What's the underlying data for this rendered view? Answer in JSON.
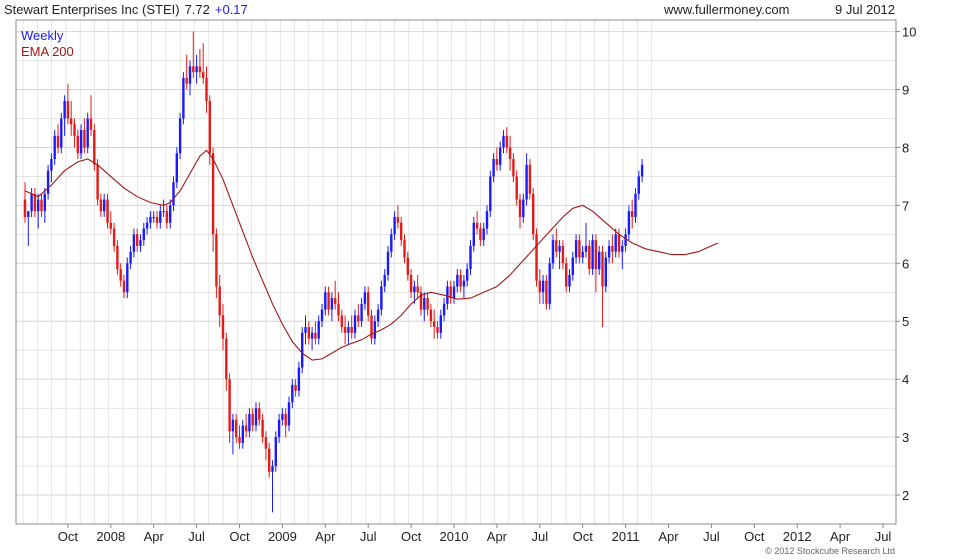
{
  "header": {
    "title": "Stewart Enterprises Inc (STEI)",
    "price": "7.72",
    "change": "+0.17",
    "site": "www.fullermoney.com",
    "date": "9 Jul 2012"
  },
  "legend": {
    "period": "Weekly",
    "ema": "EMA 200"
  },
  "footer": {
    "copyright": "© 2012 Stockcube Research Ltd"
  },
  "colors": {
    "up": "#1a1aff",
    "down": "#e41b17",
    "ema": "#a01818",
    "grid": "#d6d6d6",
    "axis": "#888888",
    "change_text": "#1a1aff",
    "period_text": "#1a1aff",
    "ema_text": "#a01818"
  },
  "chart_data": {
    "type": "candlestick",
    "ylim": [
      1.5,
      10.2
    ],
    "yticks": [
      "2",
      "3",
      "4",
      "5",
      "6",
      "7",
      "8",
      "9",
      "10"
    ],
    "xticks": [
      "Oct",
      "2008",
      "Apr",
      "Jul",
      "Oct",
      "2009",
      "Apr",
      "Jul",
      "Oct",
      "2010",
      "Apr",
      "Jul",
      "Oct",
      "2011",
      "Apr",
      "Jul",
      "Oct",
      "2012",
      "Apr",
      "Jul"
    ],
    "xtick_weeks": [
      13,
      26,
      39,
      52,
      65,
      78,
      91,
      104,
      117,
      130,
      143,
      156,
      169,
      182,
      195,
      208,
      221,
      234,
      247,
      260
    ],
    "candles": [
      [
        7.1,
        7.4,
        6.7,
        6.8
      ],
      [
        6.8,
        6.9,
        6.3,
        6.9
      ],
      [
        6.9,
        7.3,
        6.8,
        7.2
      ],
      [
        7.2,
        7.3,
        6.8,
        6.9
      ],
      [
        6.9,
        7.2,
        6.6,
        7.1
      ],
      [
        7.1,
        7.2,
        6.8,
        6.9
      ],
      [
        6.9,
        7.3,
        6.7,
        7.2
      ],
      [
        7.2,
        7.7,
        7.1,
        7.6
      ],
      [
        7.6,
        7.9,
        7.4,
        7.8
      ],
      [
        7.8,
        8.3,
        7.7,
        8.2
      ],
      [
        8.2,
        8.4,
        7.9,
        8.0
      ],
      [
        8.0,
        8.6,
        7.9,
        8.5
      ],
      [
        8.5,
        8.9,
        8.2,
        8.8
      ],
      [
        8.8,
        9.1,
        8.4,
        8.5
      ],
      [
        8.5,
        8.8,
        8.2,
        8.4
      ],
      [
        8.4,
        8.5,
        8.0,
        8.2
      ],
      [
        8.2,
        8.3,
        7.8,
        7.9
      ],
      [
        7.9,
        8.4,
        7.8,
        8.3
      ],
      [
        8.3,
        8.5,
        7.9,
        8.0
      ],
      [
        8.0,
        8.6,
        7.9,
        8.5
      ],
      [
        8.5,
        8.9,
        8.2,
        8.3
      ],
      [
        8.3,
        8.4,
        7.6,
        7.7
      ],
      [
        7.7,
        7.8,
        7.0,
        7.1
      ],
      [
        7.1,
        7.2,
        6.8,
        6.9
      ],
      [
        6.9,
        7.2,
        6.8,
        7.1
      ],
      [
        7.1,
        7.2,
        6.6,
        6.7
      ],
      [
        6.7,
        6.9,
        6.5,
        6.6
      ],
      [
        6.6,
        6.7,
        6.2,
        6.3
      ],
      [
        6.3,
        6.4,
        5.8,
        5.9
      ],
      [
        5.9,
        6.0,
        5.6,
        5.7
      ],
      [
        5.7,
        5.8,
        5.4,
        5.5
      ],
      [
        5.5,
        6.1,
        5.4,
        6.0
      ],
      [
        6.0,
        6.3,
        5.9,
        6.2
      ],
      [
        6.2,
        6.6,
        6.1,
        6.5
      ],
      [
        6.5,
        6.6,
        6.2,
        6.3
      ],
      [
        6.3,
        6.5,
        6.2,
        6.4
      ],
      [
        6.4,
        6.7,
        6.3,
        6.6
      ],
      [
        6.6,
        6.8,
        6.5,
        6.7
      ],
      [
        6.7,
        6.9,
        6.6,
        6.8
      ],
      [
        6.8,
        6.9,
        6.7,
        6.8
      ],
      [
        6.8,
        6.9,
        6.6,
        6.7
      ],
      [
        6.7,
        7.0,
        6.6,
        6.9
      ],
      [
        6.9,
        7.1,
        6.8,
        6.9
      ],
      [
        6.9,
        7.0,
        6.6,
        6.7
      ],
      [
        6.7,
        7.1,
        6.6,
        7.0
      ],
      [
        7.0,
        7.5,
        6.9,
        7.4
      ],
      [
        7.4,
        8.0,
        7.3,
        7.9
      ],
      [
        7.9,
        8.6,
        7.8,
        8.5
      ],
      [
        8.5,
        9.3,
        8.4,
        9.2
      ],
      [
        9.2,
        9.6,
        9.0,
        9.1
      ],
      [
        9.1,
        9.5,
        8.9,
        9.4
      ],
      [
        9.4,
        10.0,
        9.2,
        9.3
      ],
      [
        9.3,
        9.6,
        9.1,
        9.4
      ],
      [
        9.4,
        9.7,
        9.2,
        9.3
      ],
      [
        9.3,
        9.8,
        9.1,
        9.2
      ],
      [
        9.2,
        9.4,
        8.6,
        8.8
      ],
      [
        8.8,
        8.9,
        7.7,
        7.9
      ],
      [
        7.9,
        8.0,
        6.2,
        6.5
      ],
      [
        6.5,
        6.6,
        5.4,
        5.6
      ],
      [
        5.6,
        5.8,
        4.9,
        5.1
      ],
      [
        5.1,
        5.3,
        4.5,
        4.7
      ],
      [
        4.7,
        4.8,
        3.8,
        4.0
      ],
      [
        4.0,
        4.1,
        2.9,
        3.1
      ],
      [
        3.1,
        3.4,
        2.7,
        3.3
      ],
      [
        3.3,
        3.4,
        2.9,
        3.0
      ],
      [
        3.0,
        3.2,
        2.8,
        2.9
      ],
      [
        2.9,
        3.3,
        2.8,
        3.2
      ],
      [
        3.2,
        3.4,
        3.0,
        3.1
      ],
      [
        3.1,
        3.5,
        3.0,
        3.4
      ],
      [
        3.4,
        3.5,
        3.1,
        3.2
      ],
      [
        3.2,
        3.6,
        3.1,
        3.5
      ],
      [
        3.5,
        3.6,
        3.2,
        3.3
      ],
      [
        3.3,
        3.4,
        2.9,
        3.0
      ],
      [
        3.0,
        3.1,
        2.6,
        2.8
      ],
      [
        2.8,
        2.9,
        2.3,
        2.4
      ],
      [
        2.4,
        2.6,
        1.7,
        2.5
      ],
      [
        2.5,
        3.1,
        2.4,
        3.0
      ],
      [
        3.0,
        3.4,
        2.9,
        3.3
      ],
      [
        3.3,
        3.5,
        3.2,
        3.4
      ],
      [
        3.4,
        3.5,
        3.0,
        3.2
      ],
      [
        3.2,
        3.7,
        3.1,
        3.6
      ],
      [
        3.6,
        4.0,
        3.5,
        3.9
      ],
      [
        3.9,
        4.0,
        3.7,
        3.8
      ],
      [
        3.8,
        4.3,
        3.7,
        4.2
      ],
      [
        4.2,
        4.9,
        4.1,
        4.8
      ],
      [
        4.8,
        5.1,
        4.6,
        4.9
      ],
      [
        4.9,
        5.0,
        4.6,
        4.7
      ],
      [
        4.7,
        4.9,
        4.5,
        4.8
      ],
      [
        4.8,
        5.0,
        4.6,
        4.7
      ],
      [
        4.7,
        5.1,
        4.6,
        5.0
      ],
      [
        5.0,
        5.3,
        4.9,
        5.2
      ],
      [
        5.2,
        5.6,
        5.1,
        5.5
      ],
      [
        5.5,
        5.6,
        5.1,
        5.2
      ],
      [
        5.2,
        5.5,
        5.0,
        5.4
      ],
      [
        5.4,
        5.7,
        5.2,
        5.3
      ],
      [
        5.3,
        5.5,
        5.0,
        5.1
      ],
      [
        5.1,
        5.2,
        4.8,
        4.9
      ],
      [
        4.9,
        5.1,
        4.6,
        4.8
      ],
      [
        4.8,
        5.0,
        4.6,
        4.9
      ],
      [
        4.9,
        5.1,
        4.7,
        4.8
      ],
      [
        4.8,
        5.2,
        4.7,
        5.1
      ],
      [
        5.1,
        5.3,
        4.9,
        5.0
      ],
      [
        5.0,
        5.4,
        4.9,
        5.3
      ],
      [
        5.3,
        5.6,
        5.2,
        5.5
      ],
      [
        5.5,
        5.6,
        5.0,
        5.1
      ],
      [
        5.1,
        5.2,
        4.6,
        4.7
      ],
      [
        4.7,
        5.1,
        4.6,
        5.0
      ],
      [
        5.0,
        5.3,
        4.9,
        5.2
      ],
      [
        5.2,
        5.7,
        5.1,
        5.6
      ],
      [
        5.6,
        5.9,
        5.5,
        5.8
      ],
      [
        5.8,
        6.3,
        5.7,
        6.2
      ],
      [
        6.2,
        6.6,
        6.1,
        6.5
      ],
      [
        6.5,
        6.9,
        6.4,
        6.8
      ],
      [
        6.8,
        7.0,
        6.6,
        6.7
      ],
      [
        6.7,
        6.8,
        6.3,
        6.4
      ],
      [
        6.4,
        6.5,
        6.0,
        6.1
      ],
      [
        6.1,
        6.2,
        5.7,
        5.8
      ],
      [
        5.8,
        5.9,
        5.4,
        5.5
      ],
      [
        5.5,
        5.7,
        5.3,
        5.6
      ],
      [
        5.6,
        5.8,
        5.4,
        5.5
      ],
      [
        5.5,
        5.6,
        5.1,
        5.2
      ],
      [
        5.2,
        5.5,
        5.0,
        5.4
      ],
      [
        5.4,
        5.5,
        5.1,
        5.2
      ],
      [
        5.2,
        5.3,
        4.9,
        5.0
      ],
      [
        5.0,
        5.2,
        4.7,
        4.9
      ],
      [
        4.9,
        5.0,
        4.7,
        4.8
      ],
      [
        4.8,
        5.2,
        4.7,
        5.1
      ],
      [
        5.1,
        5.4,
        5.0,
        5.3
      ],
      [
        5.3,
        5.7,
        5.2,
        5.6
      ],
      [
        5.6,
        5.7,
        5.3,
        5.4
      ],
      [
        5.4,
        5.7,
        5.3,
        5.6
      ],
      [
        5.6,
        5.9,
        5.5,
        5.8
      ],
      [
        5.8,
        5.9,
        5.5,
        5.6
      ],
      [
        5.6,
        5.8,
        5.4,
        5.7
      ],
      [
        5.7,
        6.0,
        5.6,
        5.9
      ],
      [
        5.9,
        6.4,
        5.8,
        6.3
      ],
      [
        6.3,
        6.8,
        6.2,
        6.7
      ],
      [
        6.7,
        6.9,
        6.5,
        6.6
      ],
      [
        6.6,
        6.7,
        6.3,
        6.4
      ],
      [
        6.4,
        6.7,
        6.3,
        6.6
      ],
      [
        6.6,
        7.0,
        6.5,
        6.9
      ],
      [
        6.9,
        7.6,
        6.8,
        7.5
      ],
      [
        7.5,
        7.9,
        7.4,
        7.8
      ],
      [
        7.8,
        8.0,
        7.6,
        7.7
      ],
      [
        7.7,
        8.1,
        7.6,
        8.0
      ],
      [
        8.0,
        8.3,
        7.9,
        8.2
      ],
      [
        8.2,
        8.35,
        7.9,
        8.0
      ],
      [
        8.0,
        8.2,
        7.6,
        7.8
      ],
      [
        7.8,
        7.9,
        7.4,
        7.5
      ],
      [
        7.5,
        7.6,
        7.0,
        7.1
      ],
      [
        7.1,
        7.2,
        6.6,
        6.8
      ],
      [
        6.8,
        7.2,
        6.7,
        7.1
      ],
      [
        7.1,
        7.9,
        7.0,
        7.7
      ],
      [
        7.7,
        7.8,
        7.1,
        7.2
      ],
      [
        7.2,
        7.3,
        6.4,
        6.5
      ],
      [
        6.5,
        6.6,
        5.6,
        5.7
      ],
      [
        5.7,
        5.9,
        5.3,
        5.5
      ],
      [
        5.5,
        5.8,
        5.3,
        5.7
      ],
      [
        5.7,
        5.8,
        5.2,
        5.3
      ],
      [
        5.3,
        6.1,
        5.2,
        6.0
      ],
      [
        6.0,
        6.5,
        5.9,
        6.4
      ],
      [
        6.4,
        6.6,
        6.1,
        6.2
      ],
      [
        6.2,
        6.4,
        5.9,
        6.3
      ],
      [
        6.3,
        6.4,
        5.9,
        6.0
      ],
      [
        6.0,
        6.1,
        5.5,
        5.6
      ],
      [
        5.6,
        5.9,
        5.5,
        5.8
      ],
      [
        5.8,
        6.2,
        5.7,
        6.1
      ],
      [
        6.1,
        6.5,
        6.0,
        6.4
      ],
      [
        6.4,
        6.5,
        6.0,
        6.1
      ],
      [
        6.1,
        6.3,
        6.0,
        6.2
      ],
      [
        6.2,
        6.7,
        6.1,
        6.3
      ],
      [
        6.3,
        6.4,
        5.8,
        5.9
      ],
      [
        5.9,
        6.5,
        5.8,
        6.4
      ],
      [
        6.4,
        6.5,
        5.5,
        5.9
      ],
      [
        5.9,
        6.3,
        5.8,
        6.2
      ],
      [
        6.2,
        6.3,
        4.9,
        5.6
      ],
      [
        5.6,
        6.2,
        5.5,
        6.1
      ],
      [
        6.1,
        6.4,
        6.0,
        6.3
      ],
      [
        6.3,
        6.5,
        6.0,
        6.2
      ],
      [
        6.2,
        6.6,
        6.1,
        6.5
      ],
      [
        6.5,
        6.6,
        6.1,
        6.2
      ],
      [
        6.2,
        6.4,
        5.9,
        6.3
      ],
      [
        6.3,
        6.6,
        6.2,
        6.5
      ],
      [
        6.5,
        7.0,
        6.4,
        6.9
      ],
      [
        6.9,
        7.1,
        6.6,
        6.8
      ],
      [
        6.8,
        7.3,
        6.7,
        7.2
      ],
      [
        7.2,
        7.6,
        7.1,
        7.5
      ],
      [
        7.5,
        7.8,
        7.4,
        7.7
      ]
    ],
    "ema": [
      [
        0,
        7.25
      ],
      [
        4,
        7.15
      ],
      [
        8,
        7.35
      ],
      [
        12,
        7.6
      ],
      [
        16,
        7.75
      ],
      [
        19,
        7.8
      ],
      [
        22,
        7.7
      ],
      [
        26,
        7.5
      ],
      [
        30,
        7.3
      ],
      [
        34,
        7.15
      ],
      [
        38,
        7.05
      ],
      [
        42,
        7.0
      ],
      [
        44,
        7.05
      ],
      [
        47,
        7.25
      ],
      [
        50,
        7.55
      ],
      [
        53,
        7.85
      ],
      [
        55,
        7.95
      ],
      [
        57,
        7.8
      ],
      [
        60,
        7.45
      ],
      [
        63,
        7.0
      ],
      [
        66,
        6.55
      ],
      [
        69,
        6.1
      ],
      [
        72,
        5.7
      ],
      [
        75,
        5.3
      ],
      [
        78,
        4.95
      ],
      [
        81,
        4.65
      ],
      [
        84,
        4.45
      ],
      [
        87,
        4.33
      ],
      [
        90,
        4.35
      ],
      [
        93,
        4.45
      ],
      [
        96,
        4.55
      ],
      [
        99,
        4.62
      ],
      [
        102,
        4.68
      ],
      [
        105,
        4.78
      ],
      [
        108,
        4.85
      ],
      [
        111,
        4.95
      ],
      [
        114,
        5.1
      ],
      [
        117,
        5.3
      ],
      [
        120,
        5.45
      ],
      [
        123,
        5.5
      ],
      [
        127,
        5.45
      ],
      [
        131,
        5.38
      ],
      [
        135,
        5.4
      ],
      [
        139,
        5.5
      ],
      [
        143,
        5.6
      ],
      [
        147,
        5.8
      ],
      [
        151,
        6.05
      ],
      [
        155,
        6.3
      ],
      [
        159,
        6.55
      ],
      [
        163,
        6.8
      ],
      [
        166,
        6.95
      ],
      [
        169,
        7.0
      ],
      [
        172,
        6.9
      ],
      [
        176,
        6.7
      ],
      [
        180,
        6.5
      ],
      [
        184,
        6.35
      ],
      [
        188,
        6.25
      ],
      [
        192,
        6.2
      ],
      [
        196,
        6.15
      ],
      [
        200,
        6.15
      ],
      [
        204,
        6.2
      ],
      [
        208,
        6.3
      ],
      [
        210,
        6.35
      ]
    ]
  }
}
